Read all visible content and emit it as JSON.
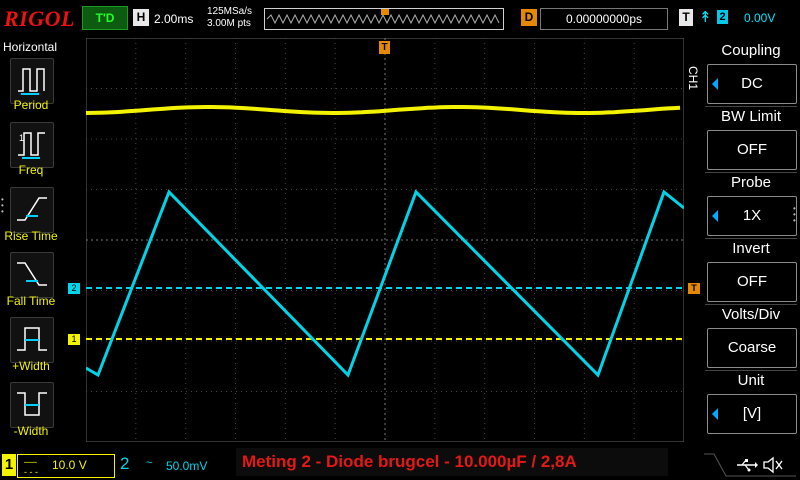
{
  "header": {
    "logo": "RIGOL",
    "trigger_status": "T'D",
    "horizontal_badge": "H",
    "timebase": "2.00ms",
    "sample_rate": "125MSa/s",
    "memory_depth": "3.00M pts",
    "delay_badge": "D",
    "delay_value": "0.00000000ps",
    "trigger_badge": "T",
    "trigger_source": "2",
    "trigger_level": "0.00V"
  },
  "left_menu": {
    "title": "Horizontal",
    "items": [
      {
        "label": "Period",
        "icon": "period-icon"
      },
      {
        "label": "Freq",
        "icon": "freq-icon"
      },
      {
        "label": "Rise Time",
        "icon": "rise-time-icon"
      },
      {
        "label": "Fall Time",
        "icon": "fall-time-icon"
      },
      {
        "label": "+Width",
        "icon": "pos-width-icon"
      },
      {
        "label": "-Width",
        "icon": "neg-width-icon"
      }
    ]
  },
  "right_menu": {
    "channel_tab": "CH1",
    "items": [
      {
        "title": "Coupling",
        "value": "DC",
        "has_arrow": true
      },
      {
        "title": "BW Limit",
        "value": "OFF",
        "has_arrow": false
      },
      {
        "title": "Probe",
        "value": "1X",
        "has_arrow": true
      },
      {
        "title": "Invert",
        "value": "OFF",
        "has_arrow": false
      },
      {
        "title": "Volts/Div",
        "value": "Coarse",
        "has_arrow": false
      },
      {
        "title": "Unit",
        "value": "[V]",
        "has_arrow": true
      }
    ]
  },
  "markers": {
    "ch1": "1",
    "ch2": "2",
    "trigger": "T"
  },
  "bottom": {
    "ch1_number": "1",
    "ch1_coupling": "DC",
    "ch1_scale": "10.0 V",
    "ch2_number": "2",
    "ch2_coupling": "~",
    "ch2_scale": "50.0mV",
    "caption": "Meting 2 - Diode brugcel - 10.000µF / 2,8A"
  },
  "colors": {
    "ch1": "#f3f300",
    "ch2": "#00d4e8",
    "trigger": "#e58a00",
    "caption": "#e41818"
  }
}
